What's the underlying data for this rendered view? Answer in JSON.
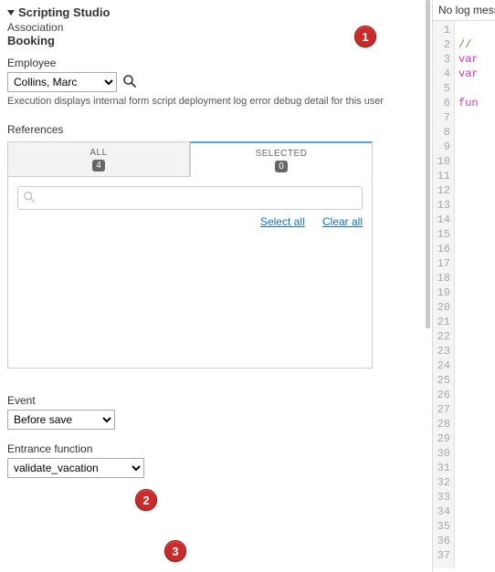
{
  "panel": {
    "title": "Scripting Studio",
    "association_label": "Association",
    "association_value": "Booking"
  },
  "employee": {
    "label": "Employee",
    "selected": "Collins, Marc",
    "options": [
      "Collins, Marc"
    ],
    "help": "Execution displays internal form script deployment log error debug detail for this user"
  },
  "references": {
    "label": "References",
    "tabs": {
      "all_label": "ALL",
      "all_count": "4",
      "selected_label": "SELECTED",
      "selected_count": "0"
    },
    "filter_placeholder": "",
    "select_all": "Select all",
    "clear_all": "Clear all"
  },
  "event": {
    "label": "Event",
    "selected": "Before save",
    "options": [
      "Before save"
    ]
  },
  "entrance": {
    "label": "Entrance function",
    "selected": "validate_vacation",
    "options": [
      "validate_vacation"
    ]
  },
  "callouts": {
    "c1": "1",
    "c2": "2",
    "c3": "3"
  },
  "right": {
    "log_header": "No log messa",
    "code": {
      "line1": "//",
      "line2": "var",
      "line3": "var",
      "line5": "fun"
    },
    "line_count": 37
  }
}
